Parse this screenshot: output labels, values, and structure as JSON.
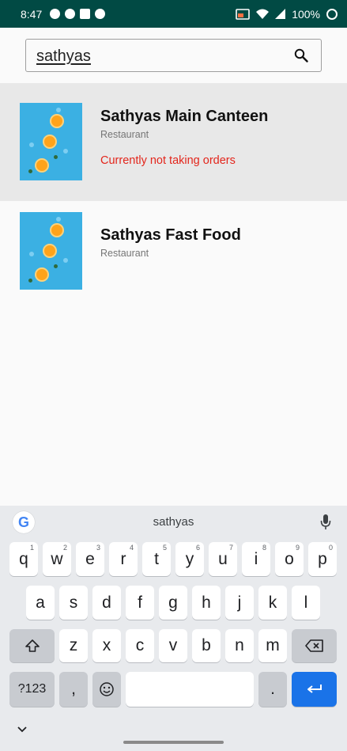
{
  "status_bar": {
    "time": "8:47",
    "battery": "100%"
  },
  "search": {
    "query": "sathyas"
  },
  "results": [
    {
      "name": "Sathyas Main Canteen",
      "category": "Restaurant",
      "notice": "Currently not taking orders"
    },
    {
      "name": "Sathyas Fast Food",
      "category": "Restaurant"
    }
  ],
  "keyboard": {
    "suggestion": "sathyas",
    "row1": [
      "q",
      "w",
      "e",
      "r",
      "t",
      "y",
      "u",
      "i",
      "o",
      "p"
    ],
    "row1_hints": [
      "1",
      "2",
      "3",
      "4",
      "5",
      "6",
      "7",
      "8",
      "9",
      "0"
    ],
    "row2": [
      "a",
      "s",
      "d",
      "f",
      "g",
      "h",
      "j",
      "k",
      "l"
    ],
    "row3": [
      "z",
      "x",
      "c",
      "v",
      "b",
      "n",
      "m"
    ],
    "symbols_label": "?123",
    "comma": ",",
    "period": "."
  },
  "colors": {
    "status_bar": "#014a44",
    "accent_red": "#e3261c",
    "enter_blue": "#1a73e8",
    "thumb_blue": "#3bb0e3"
  }
}
